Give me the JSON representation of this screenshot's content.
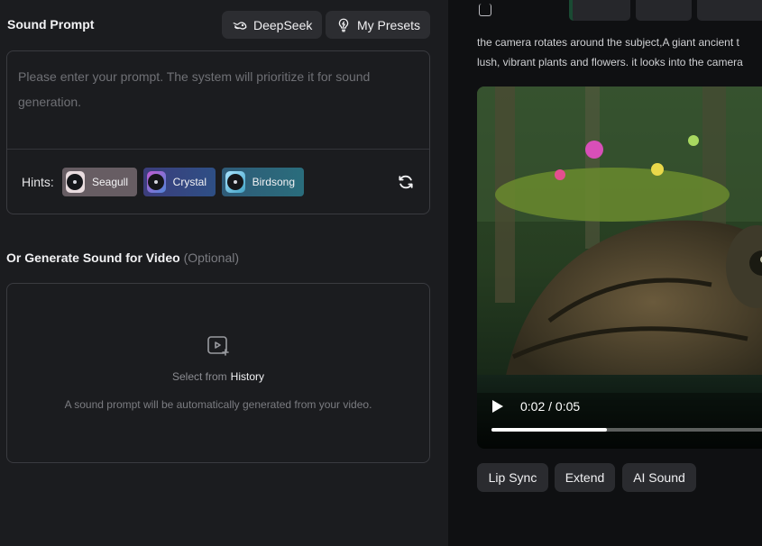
{
  "left_panel": {
    "title": "Sound Prompt",
    "deepseek_label": "DeepSeek",
    "presets_label": "My Presets",
    "prompt": {
      "value": "",
      "placeholder": "Please enter your prompt. The system will prioritize it for sound generation."
    },
    "hints_label": "Hints:",
    "hints": [
      "Seagull",
      "Crystal",
      "Birdsong"
    ],
    "video_section": {
      "title": "Or Generate Sound for Video",
      "optional": "(Optional)",
      "select_from": "Select from",
      "history_link": "History",
      "note": "A sound prompt will be automatically generated from your video."
    }
  },
  "right_panel": {
    "description_lines": [
      "the camera rotates around the subject,A giant ancient t",
      "lush, vibrant plants and flowers. it looks into the camera"
    ],
    "video": {
      "time": "0:02 / 0:05",
      "progress": 0.4
    },
    "actions": [
      "Lip Sync",
      "Extend",
      "AI Sound"
    ]
  },
  "icons": {
    "deepseek": "whale-icon",
    "presets": "bulb-icon",
    "refresh": "refresh-icon",
    "upload": "video-add-icon",
    "play": "play-icon"
  }
}
